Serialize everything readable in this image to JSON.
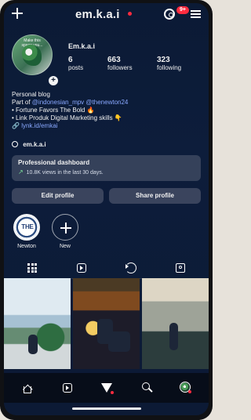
{
  "header": {
    "username": "em.k.a.i",
    "notifications_badge": "9+"
  },
  "profile": {
    "display_name": "Em.k.a.i",
    "avatar_note": "Make this space you...",
    "stats": [
      {
        "value": "6",
        "label": "posts"
      },
      {
        "value": "663",
        "label": "followers"
      },
      {
        "value": "323",
        "label": "following"
      }
    ],
    "bio": {
      "category": "Personal blog",
      "line1_prefix": "Part of ",
      "line1_link1": "@indonesian_mpv",
      "line1_link2": "@thenewton24",
      "line2": "• Fortune Favors The Bold 🔥",
      "line3": "• Link Produk Digital Marketing skills 👇",
      "link": "lynk.id/emkai",
      "threads_handle": "em.k.a.i"
    }
  },
  "dashboard": {
    "title": "Professional dashboard",
    "subtitle": "10.8K views in the last 30 days."
  },
  "actions": {
    "edit_profile": "Edit profile",
    "share_profile": "Share profile"
  },
  "highlights": [
    {
      "label": "Newton",
      "badge_text": "THE"
    },
    {
      "label": "New"
    }
  ],
  "tabs": [
    {
      "name": "grid"
    },
    {
      "name": "reels"
    },
    {
      "name": "reposts"
    },
    {
      "name": "tagged"
    }
  ],
  "bottom_nav": [
    {
      "name": "home"
    },
    {
      "name": "reels"
    },
    {
      "name": "send"
    },
    {
      "name": "search"
    },
    {
      "name": "profile"
    }
  ],
  "colors": {
    "background": "#0c1a35",
    "accent_red": "#ff2b3f",
    "link_blue": "#89a8ff",
    "dashboard_bg": "#434d65"
  }
}
